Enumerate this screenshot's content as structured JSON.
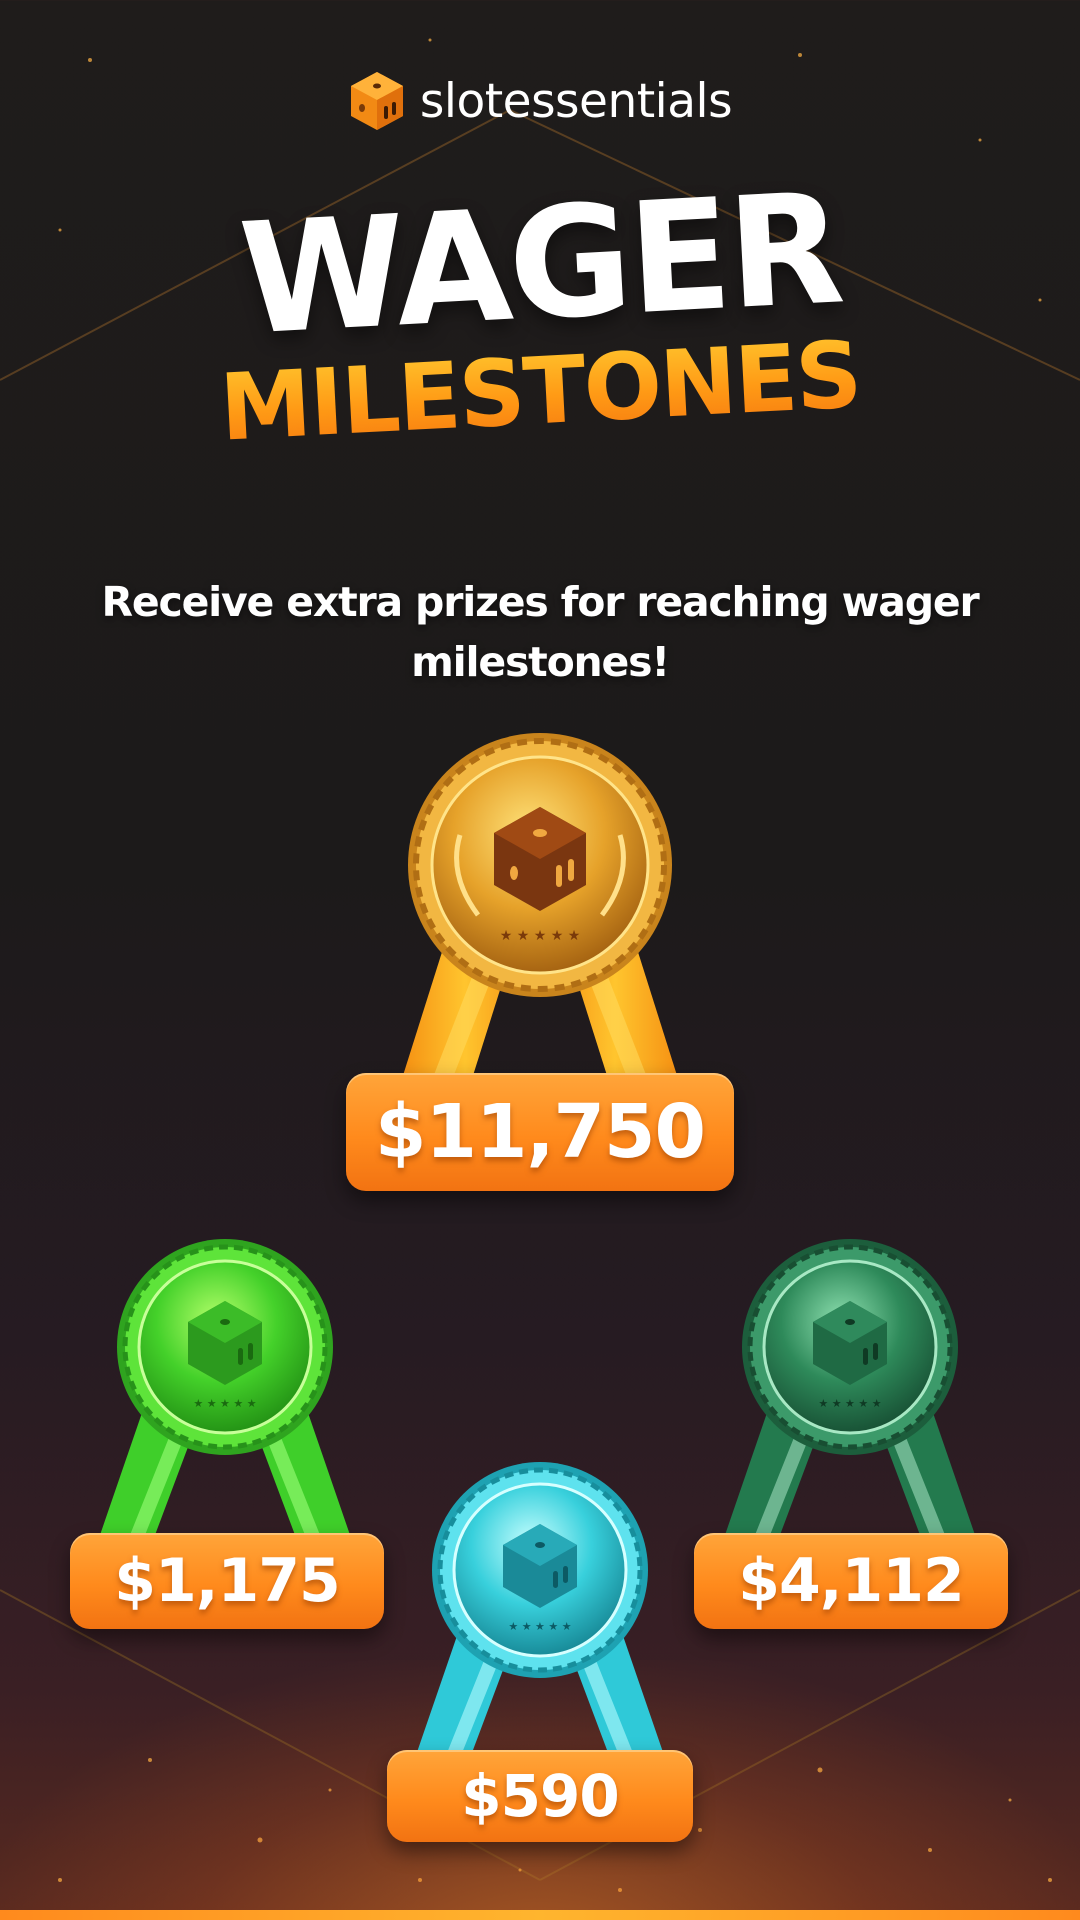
{
  "brand": {
    "name": "slotessentials",
    "logo_icon": "dice-cube-icon"
  },
  "title": {
    "line1": "WAGER",
    "line2": "MILESTONES"
  },
  "subtitle": "Receive extra prizes for reaching wager milestones!",
  "colors": {
    "accent": "#ff9a15",
    "gold": "#e0a023",
    "green": "#3fcf2a",
    "dark_green": "#237a4e",
    "cyan": "#2fc9d8"
  },
  "milestones": [
    {
      "tier": "gold",
      "amount": "$11,750"
    },
    {
      "tier": "green",
      "amount": "$1,175"
    },
    {
      "tier": "cyan",
      "amount": "$590"
    },
    {
      "tier": "dark-green",
      "amount": "$4,112"
    }
  ]
}
